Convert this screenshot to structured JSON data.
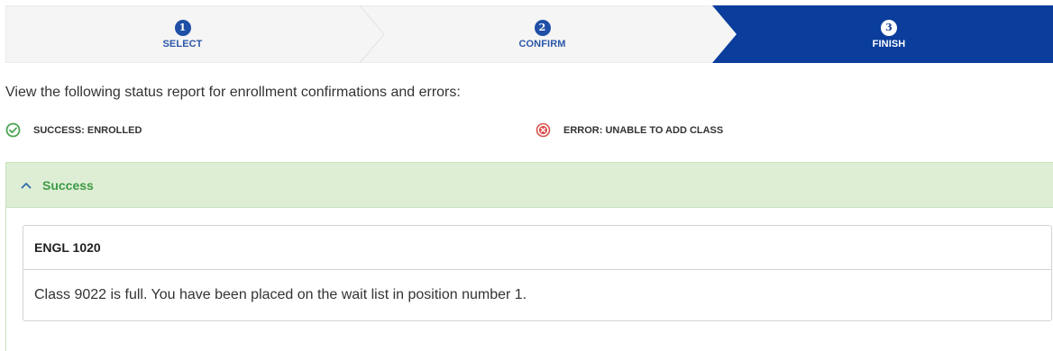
{
  "stepper": {
    "steps": [
      {
        "number": "1",
        "label": "SELECT",
        "state": "done"
      },
      {
        "number": "2",
        "label": "CONFIRM",
        "state": "done"
      },
      {
        "number": "3",
        "label": "FINISH",
        "state": "active"
      }
    ],
    "colors": {
      "inactive_bg": "#f5f5f5",
      "active_bg": "#0a3d9c",
      "divider": "#e2e2e2"
    }
  },
  "intro": {
    "text": "View the following status report for enrollment confirmations and errors:"
  },
  "legend": {
    "success": {
      "label": "SUCCESS: ENROLLED",
      "icon": "check-circle-icon",
      "color": "#4aa451"
    },
    "error": {
      "label": "ERROR: UNABLE TO ADD CLASS",
      "icon": "x-circle-icon",
      "color": "#d9534f"
    }
  },
  "panel": {
    "title": "Success",
    "icon": "chevron-up-icon",
    "expanded": true,
    "items": [
      {
        "course": "ENGL 1020",
        "message": "Class 9022 is full. You have been placed on the wait list in position number 1."
      }
    ]
  }
}
